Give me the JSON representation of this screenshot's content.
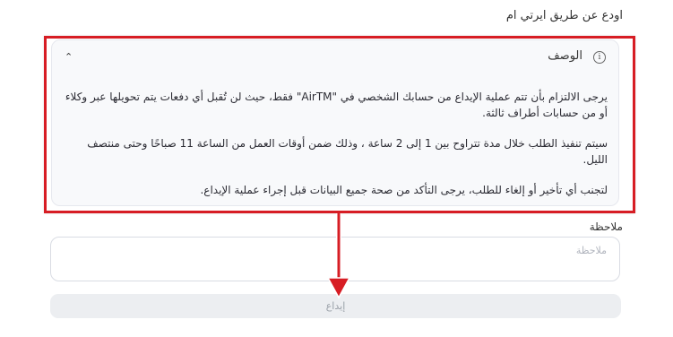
{
  "page": {
    "heading": "اودع عن طريق ايرتي ام"
  },
  "description": {
    "title": "الوصف",
    "paragraphs": [
      "يرجى الالتزام بأن تتم عملية الإيداع من حسابك الشخصي في \"AirTM\" فقط، حيث لن تُقبل أي دفعات يتم تحويلها عبر وكلاء أو من حسابات أطراف ثالثة.",
      "سيتم تنفيذ الطلب خلال مدة تتراوح بين 1 إلى 2 ساعة ، وذلك ضمن أوقات العمل من الساعة 11 صباحًا وحتى منتصف الليل.",
      "لتجنب أي تأخير أو إلغاء للطلب، يرجى التأكد من صحة جميع البيانات قبل إجراء عملية الإيداع."
    ]
  },
  "note": {
    "label": "ملاحظة",
    "placeholder": "ملاحظة",
    "value": ""
  },
  "submit": {
    "label": "إيداع"
  },
  "colors": {
    "highlight": "#d71d24",
    "card_background": "#f8f9fb",
    "button_background": "#eceef1"
  }
}
